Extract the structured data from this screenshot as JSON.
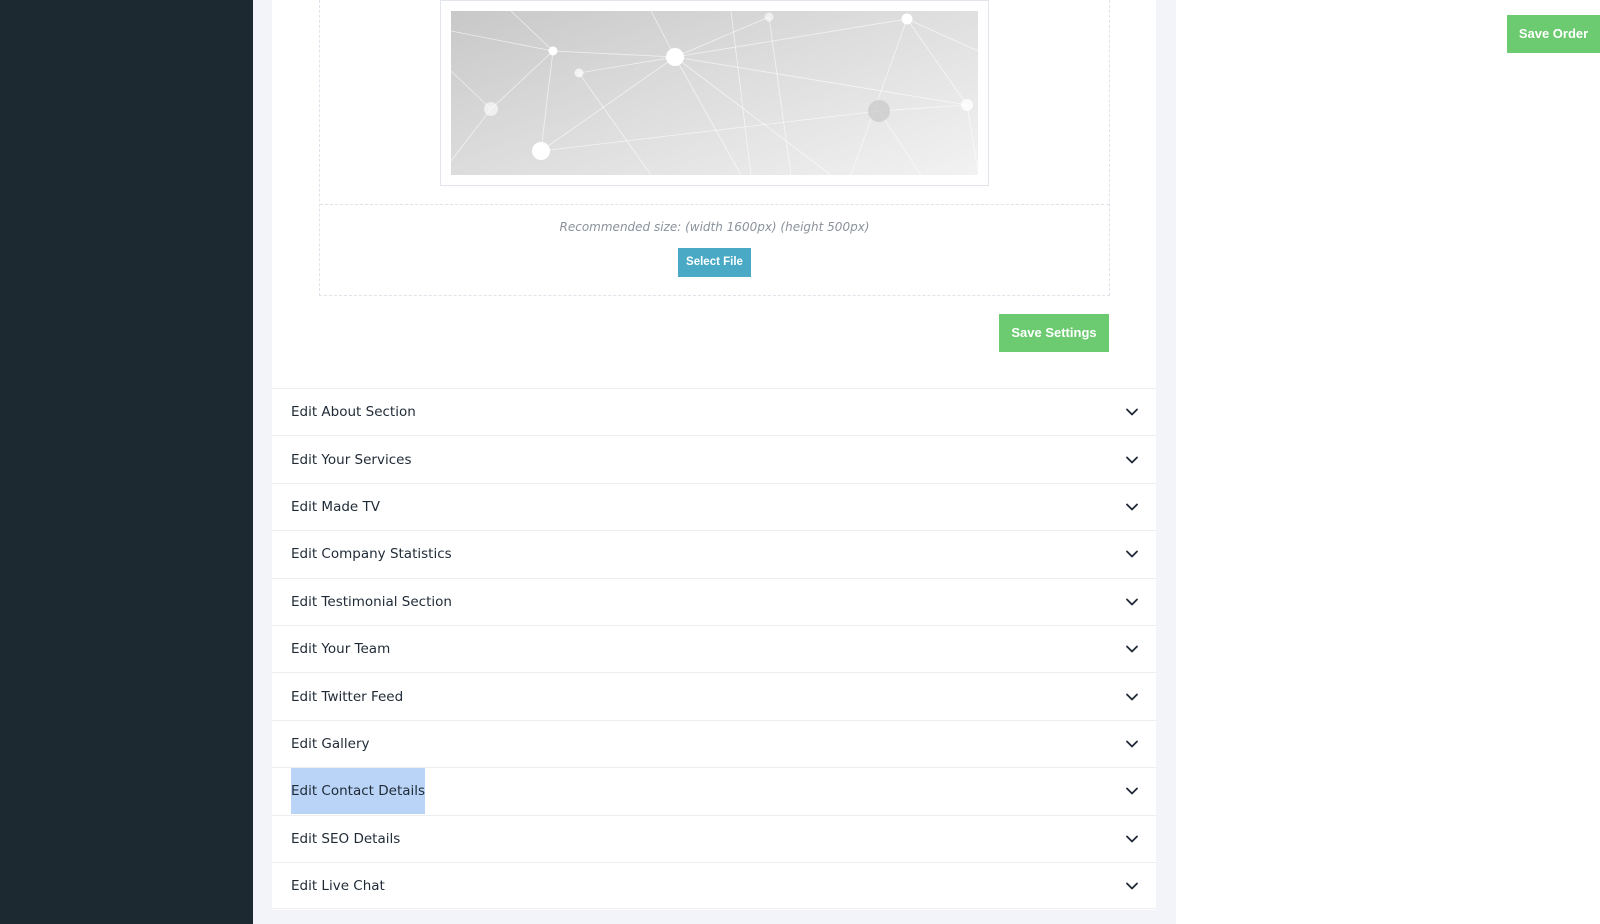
{
  "upload": {
    "recommended_size": "Recommended size: (width 1600px) (height 500px)",
    "select_file_label": "Select File"
  },
  "settings": {
    "save_label": "Save Settings"
  },
  "accordion": {
    "items": [
      {
        "label": "Edit About Section"
      },
      {
        "label": "Edit Your Services"
      },
      {
        "label": "Edit Made TV"
      },
      {
        "label": "Edit Company Statistics"
      },
      {
        "label": "Edit Testimonial Section"
      },
      {
        "label": "Edit Your Team"
      },
      {
        "label": "Edit Twitter Feed"
      },
      {
        "label": "Edit Gallery"
      },
      {
        "label": "Edit Contact Details"
      },
      {
        "label": "Edit SEO Details"
      },
      {
        "label": "Edit Live Chat"
      }
    ],
    "selected_index": 8,
    "toggle_icon": "chevron-down-icon"
  },
  "header": {
    "save_order_label": "Save Order"
  },
  "colors": {
    "sidebar": "#1c2931",
    "content_background": "#f2f4f9",
    "success_button": "#6ccb70",
    "info_button": "#4aaac6",
    "text_selection": "#b9d4f7"
  }
}
